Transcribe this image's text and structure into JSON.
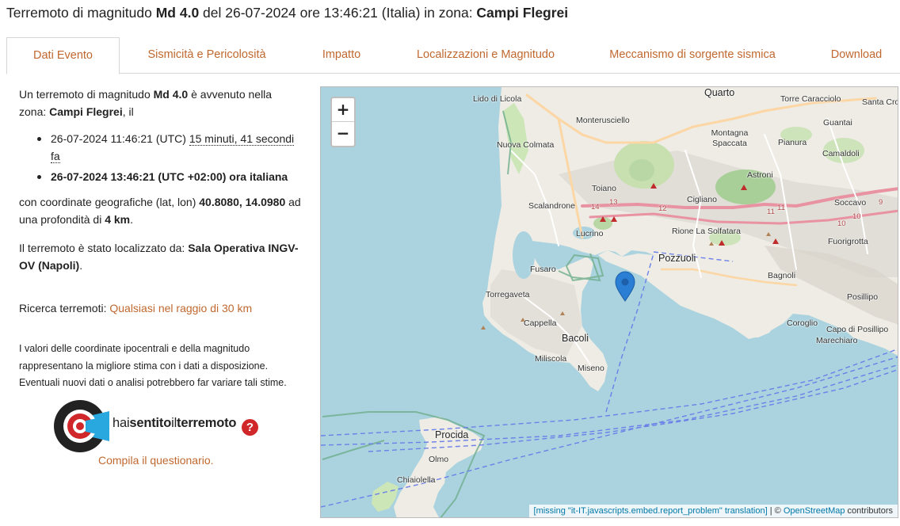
{
  "header": {
    "t1": "Terremoto di magnitudo ",
    "mag": "Md 4.0",
    "t2": " del 26-07-2024 ore 13:46:21 (Italia) in zona: ",
    "zone": "Campi Flegrei"
  },
  "tabs": [
    {
      "label": "Dati Evento"
    },
    {
      "label": "Sismicità e Pericolosità"
    },
    {
      "label": "Impatto"
    },
    {
      "label": "Localizzazioni e Magnitudo"
    },
    {
      "label": "Meccanismo di sorgente sismica"
    },
    {
      "label": "Download"
    }
  ],
  "event": {
    "p1a": "Un terremoto di magnitudo ",
    "mag": "Md 4.0",
    "p1b": " è avvenuto nella zona: ",
    "zone": "Campi Flegrei",
    "p1c": ", il",
    "utc_time": "26-07-2024 11:46:21 (UTC) ",
    "ago": "15 minuti, 41 secondi fa",
    "local_time": "26-07-2024 13:46:21 (UTC +02:00) ora italiana",
    "p2a": "con coordinate geografiche (lat, lon) ",
    "coords": "40.8080, 14.0980",
    "p2b": " ad una profondità di ",
    "depth": "4 km",
    "p2c": ".",
    "p3a": "Il terremoto è stato localizzato da: ",
    "located_by": "Sala Operativa INGV-OV (Napoli)",
    "p3b": ".",
    "search_label": "Ricerca terremoti: ",
    "search_link": "Qualsiasi nel raggio di 30 km",
    "disclaimer": "I valori delle coordinate ipocentrali e della magnitudo rappresentano la migliore stima con i dati a disposizione. Eventuali nuovi dati o analisi potrebbero far variare tali stime."
  },
  "survey": {
    "logo_t1": "hai",
    "logo_t2": "sentito",
    "logo_t3": "il",
    "logo_t4": "terremoto",
    "logo_q": "?",
    "link": "Compila il questionario."
  },
  "map": {
    "zoom_in": "+",
    "zoom_out": "−",
    "attribution_missing": "[missing \"it-IT.javascripts.embed.report_problem\" translation]",
    "attribution_sep": " | © ",
    "attribution_osm": "OpenStreetMap",
    "attribution_end": " contributors",
    "labels": [
      {
        "text": "Quarto"
      },
      {
        "text": "Lido di Licola"
      },
      {
        "text": "Monterusciello"
      },
      {
        "text": "Nuova Colmata"
      },
      {
        "text": "Torre Caracciolo"
      },
      {
        "text": "Santa Cro"
      },
      {
        "text": "Guantai"
      },
      {
        "text": "Montagna Spaccata"
      },
      {
        "text": "Pianura"
      },
      {
        "text": "Camaldoli"
      },
      {
        "text": "Astroni"
      },
      {
        "text": "Toiano"
      },
      {
        "text": "Cigliano"
      },
      {
        "text": "Soccavo"
      },
      {
        "text": "Scalandrone"
      },
      {
        "text": "Rione La Solfatara"
      },
      {
        "text": "Fuorigrotta"
      },
      {
        "text": "Lucrino"
      },
      {
        "text": "Pozzuoli"
      },
      {
        "text": "Fusaro"
      },
      {
        "text": "Bagnoli"
      },
      {
        "text": "Torregaveta"
      },
      {
        "text": "Posillipo"
      },
      {
        "text": "Cappella"
      },
      {
        "text": "Coroglio"
      },
      {
        "text": "Capo di Posillipo"
      },
      {
        "text": "Bacoli"
      },
      {
        "text": "Marechiaro"
      },
      {
        "text": "Miliscola"
      },
      {
        "text": "Miseno"
      },
      {
        "text": "Procida"
      },
      {
        "text": "Olmo"
      },
      {
        "text": "Chiaiolella"
      }
    ],
    "road_numbers": [
      "14",
      "13",
      "12",
      "11",
      "11",
      "10",
      "10",
      "9"
    ]
  }
}
